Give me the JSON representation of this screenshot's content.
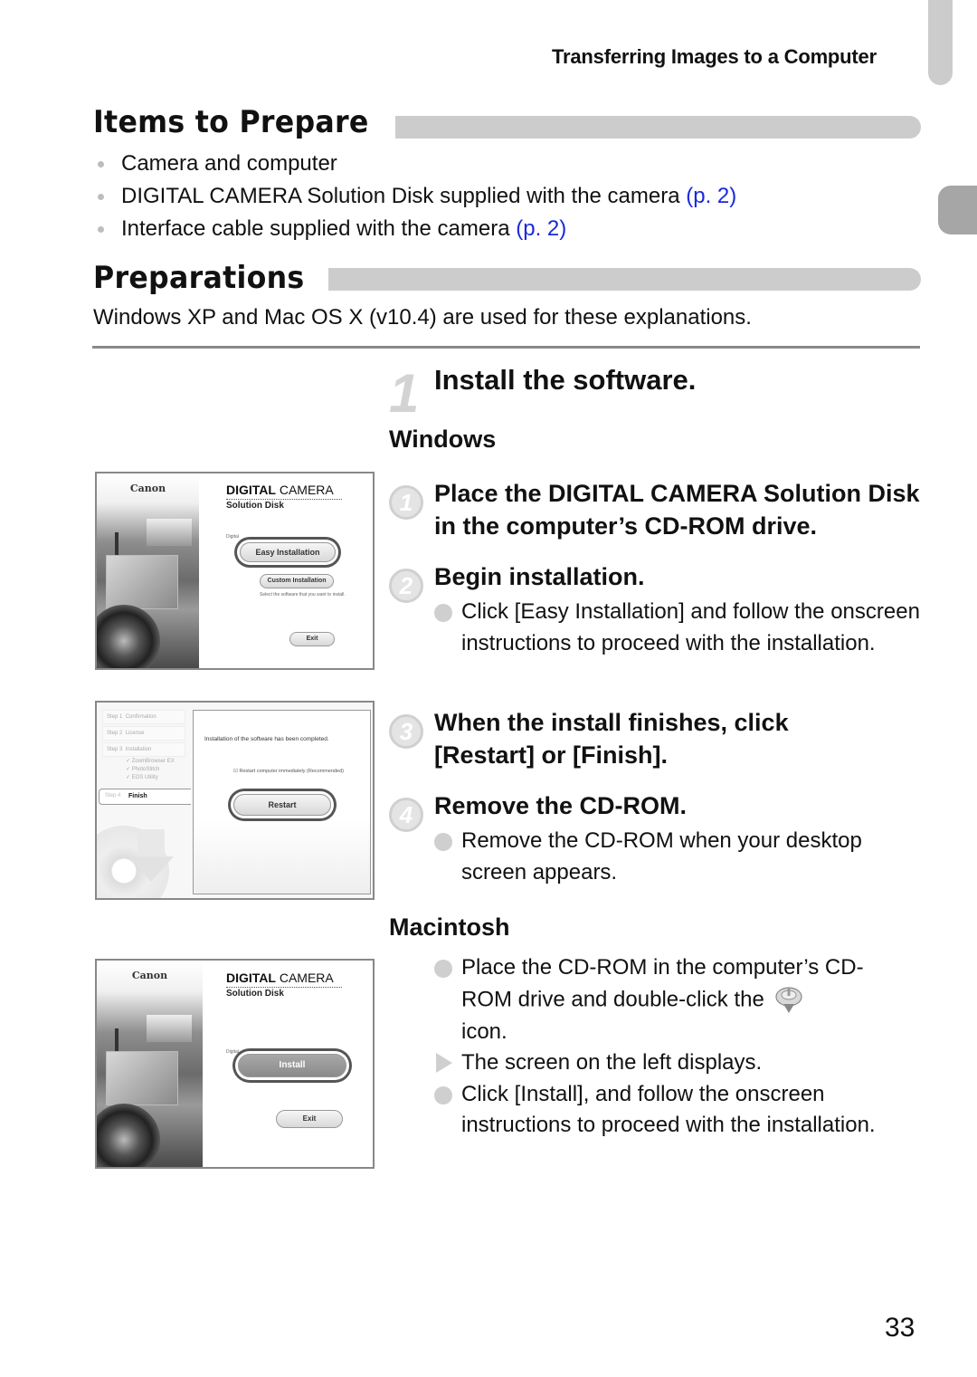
{
  "header": {
    "running_title": "Transferring Images to a Computer"
  },
  "items_to_prepare": {
    "title": "Items to Prepare",
    "items": [
      {
        "text": "Camera and computer",
        "ref": ""
      },
      {
        "text": "DIGITAL CAMERA Solution Disk supplied with the camera ",
        "ref": "(p. 2)"
      },
      {
        "text": "Interface cable supplied with the camera ",
        "ref": "(p. 2)"
      }
    ]
  },
  "preparations": {
    "title": "Preparations",
    "intro": "Windows XP and Mac OS X (v10.4) are used for these explanations."
  },
  "step": {
    "number": "1",
    "title": "Install the software.",
    "windows": {
      "heading": "Windows",
      "substeps": [
        {
          "num": "1",
          "title": "Place the DIGITAL CAMERA Solution Disk in the computer’s CD-ROM drive."
        },
        {
          "num": "2",
          "title": "Begin installation.",
          "note": "Click [Easy Installation] and follow the onscreen instructions to proceed with the installation."
        },
        {
          "num": "3",
          "title": "When the install finishes, click [Restart] or [Finish]."
        },
        {
          "num": "4",
          "title": "Remove the CD-ROM.",
          "note": "Remove the CD-ROM when your desktop screen appears."
        }
      ]
    },
    "macintosh": {
      "heading": "Macintosh",
      "bullets": [
        {
          "type": "dot",
          "text": "Place the CD-ROM in the computer’s CD-ROM drive and double-click the",
          "tail": "icon.",
          "icon": "installer-disk-icon"
        },
        {
          "type": "arrow",
          "text": "The screen on the left displays."
        },
        {
          "type": "dot",
          "text": "Click [Install], and follow the onscreen instructions to proceed with the installation."
        }
      ]
    }
  },
  "screenshots": {
    "win_installer": {
      "logo": "Canon",
      "brand_bold": "DIGITAL",
      "brand_rest": " CAMERA",
      "brand_sub": "Solution Disk",
      "digital_label": "Digital",
      "easy_button": "Easy Installation",
      "custom_button": "Custom Installation",
      "hint": "Select the software that you want to install.",
      "exit_button": "Exit"
    },
    "win_finish": {
      "steps": [
        {
          "label": "Step 1",
          "name": "Confirmation"
        },
        {
          "label": "Step 2",
          "name": "License"
        },
        {
          "label": "Step 3",
          "name": "Installation"
        }
      ],
      "installed": [
        "ZoomBrowser EX",
        "PhotoStitch",
        "EOS Utility"
      ],
      "step4_label": "Step 4",
      "step4_name": "Finish",
      "message": "Installation of the software has been completed.",
      "checkbox_label": "Restart computer immediately (Recommended)",
      "checkbox_checked": true,
      "restart_button": "Restart"
    },
    "mac_installer": {
      "logo": "Canon",
      "brand_bold": "DIGITAL",
      "brand_rest": " CAMERA",
      "brand_sub": "Solution Disk",
      "digital_label": "Digital",
      "install_button": "Install",
      "exit_button": "Exit"
    }
  },
  "footer": {
    "page_number": "33"
  }
}
